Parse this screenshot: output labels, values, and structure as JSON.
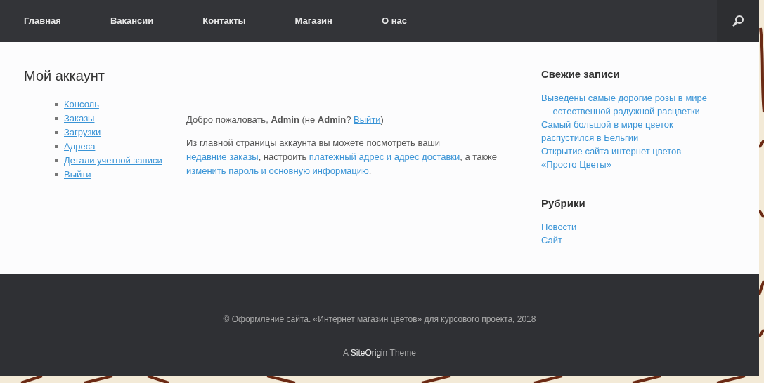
{
  "nav": {
    "items": [
      {
        "label": "Главная"
      },
      {
        "label": "Вакансии"
      },
      {
        "label": "Контакты"
      },
      {
        "label": "Магазин"
      },
      {
        "label": "О нас"
      }
    ]
  },
  "page": {
    "title": "Мой аккаунт",
    "account_menu": [
      {
        "label": "Консоль"
      },
      {
        "label": "Заказы"
      },
      {
        "label": "Загрузки"
      },
      {
        "label": "Адреса"
      },
      {
        "label": "Детали учетной записи"
      },
      {
        "label": "Выйти"
      }
    ],
    "paragraphs": [
      [
        {
          "kind": "text",
          "text": "Добро пожаловать, **Admin** (не **Admin**?"
        },
        {
          "kind": "link",
          "text": "Выйти"
        },
        {
          "kind": "text",
          "text": ")"
        }
      ],
      [
        {
          "kind": "text",
          "text": "Из главной страницы аккаунта вы можете посмотреть ваши"
        },
        {
          "kind": "link",
          "text": "недавние заказы"
        },
        {
          "kind": "text",
          "text": ", настроить"
        },
        {
          "kind": "link",
          "text": "платежный адрес и адрес доставки"
        },
        {
          "kind": "text",
          "text": ", а также"
        },
        {
          "kind": "link",
          "text": "изменить пароль и основную информацию"
        },
        {
          "kind": "text",
          "text": "."
        }
      ]
    ]
  },
  "sidebar": [
    {
      "title": "Свежие записи",
      "links": [
        "Выведены самые дорогие розы в мире — естественной радужной расцветки",
        "Самый большой в мире цветок распустился в Бельгии",
        "Открытие сайта интернет цветов «Просто Цветы»"
      ]
    },
    {
      "title": "Рубрики",
      "links": [
        "Новости",
        "Сайт"
      ]
    }
  ],
  "footer": {
    "copyright": "© Оформление сайта. «Интернет магазин цветов» для курсового проекта, 2018",
    "credit": [
      {
        "kind": "text",
        "text": "A"
      },
      {
        "kind": "link",
        "text": "SiteOrigin"
      },
      {
        "kind": "text",
        "text": "Theme"
      }
    ]
  }
}
